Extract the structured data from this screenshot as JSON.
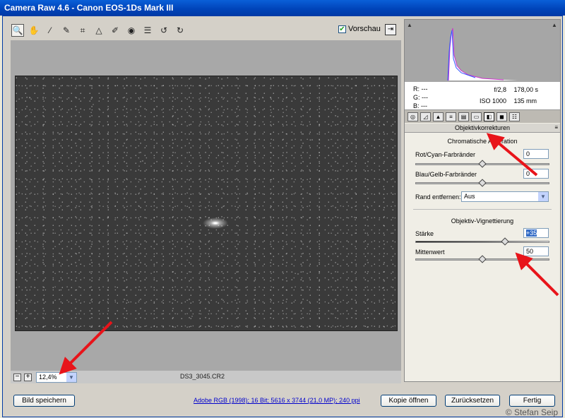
{
  "window": {
    "title": "Camera Raw 4.6 - Canon EOS-1Ds Mark III"
  },
  "toolbar": {
    "preview_label": "Vorschau",
    "preview_checked": true
  },
  "status": {
    "zoom_value": "12,4%",
    "zoom_minus": "−",
    "zoom_plus": "+",
    "filename": "DS3_3045.CR2"
  },
  "info": {
    "r_label": "R:",
    "r_value": "---",
    "g_label": "G:",
    "g_value": "---",
    "b_label": "B:",
    "b_value": "---",
    "aperture": "f/2,8",
    "shutter": "178,00 s",
    "iso": "ISO 1000",
    "focal": "135 mm"
  },
  "panel": {
    "section_title": "Objektivkorrekturen",
    "chromatic": {
      "title": "Chromatische Aberration",
      "red_cyan_label": "Rot/Cyan-Farbränder",
      "red_cyan_value": "0",
      "blue_yellow_label": "Blau/Gelb-Farbränder",
      "blue_yellow_value": "0",
      "defringe_label": "Rand entfernen:",
      "defringe_value": "Aus"
    },
    "vignette": {
      "title": "Objektiv-Vignettierung",
      "amount_label": "Stärke",
      "amount_value": "+35",
      "midpoint_label": "Mittenwert",
      "midpoint_value": "50"
    }
  },
  "bottom": {
    "save_label": "Bild speichern",
    "workflow_info": "Adobe RGB (1998); 16 Bit; 5616 x 3744 (21,0 MP); 240 ppi",
    "open_copy_label": "Kopie öffnen",
    "reset_label": "Zurücksetzen",
    "done_label": "Fertig",
    "copyright": "© Stefan Seip"
  },
  "colors": {
    "titlebar": "#0043b8",
    "arrow": "#e8141a",
    "selection": "#316ac5"
  }
}
